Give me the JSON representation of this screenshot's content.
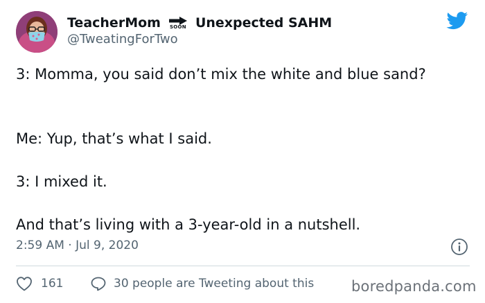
{
  "header": {
    "name_part1": "TeacherMom",
    "soon_label": "SOON",
    "name_part2": "Unexpected SAHM",
    "handle": "@TweatingForTwo"
  },
  "tweet": {
    "line1": "3: Momma, you said don’t mix the white and blue sand?",
    "line2": "Me: Yup, that’s what I said.",
    "line3": "3: I mixed it.",
    "line4": "And that’s living with a 3-year-old in a nutshell.",
    "timestamp": "2:59 AM · Jul 9, 2020"
  },
  "actions": {
    "likes": "161",
    "conversation": "30 people are Tweeting about this"
  },
  "watermark": "boredpanda.com",
  "icons": [
    "avatar",
    "arrow-right-icon",
    "twitter-bird-icon",
    "info-icon",
    "heart-icon",
    "reply-icon"
  ],
  "colors": {
    "twitter_blue": "#1d9bf0",
    "muted_text": "#536471",
    "text": "#0f1419",
    "divider": "#cfd9de"
  }
}
